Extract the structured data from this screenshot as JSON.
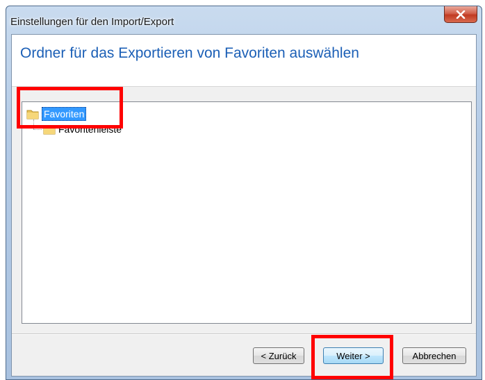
{
  "window": {
    "title": "Einstellungen für den Import/Export",
    "close_icon": "close-x-icon"
  },
  "header": {
    "heading": "Ordner für das Exportieren von Favoriten auswählen"
  },
  "tree": {
    "items": [
      {
        "label": "Favoriten",
        "icon": "folder-icon",
        "selected": true,
        "level": 0
      },
      {
        "label": "Favoritenleiste",
        "icon": "folder-icon",
        "selected": false,
        "level": 1
      }
    ]
  },
  "buttons": {
    "back": "< Zurück",
    "next": "Weiter >",
    "cancel": "Abbrechen"
  },
  "colors": {
    "heading": "#1b5fb6",
    "selection": "#3399ff",
    "annotation": "#ff0000",
    "close_button": "#c13a22"
  }
}
